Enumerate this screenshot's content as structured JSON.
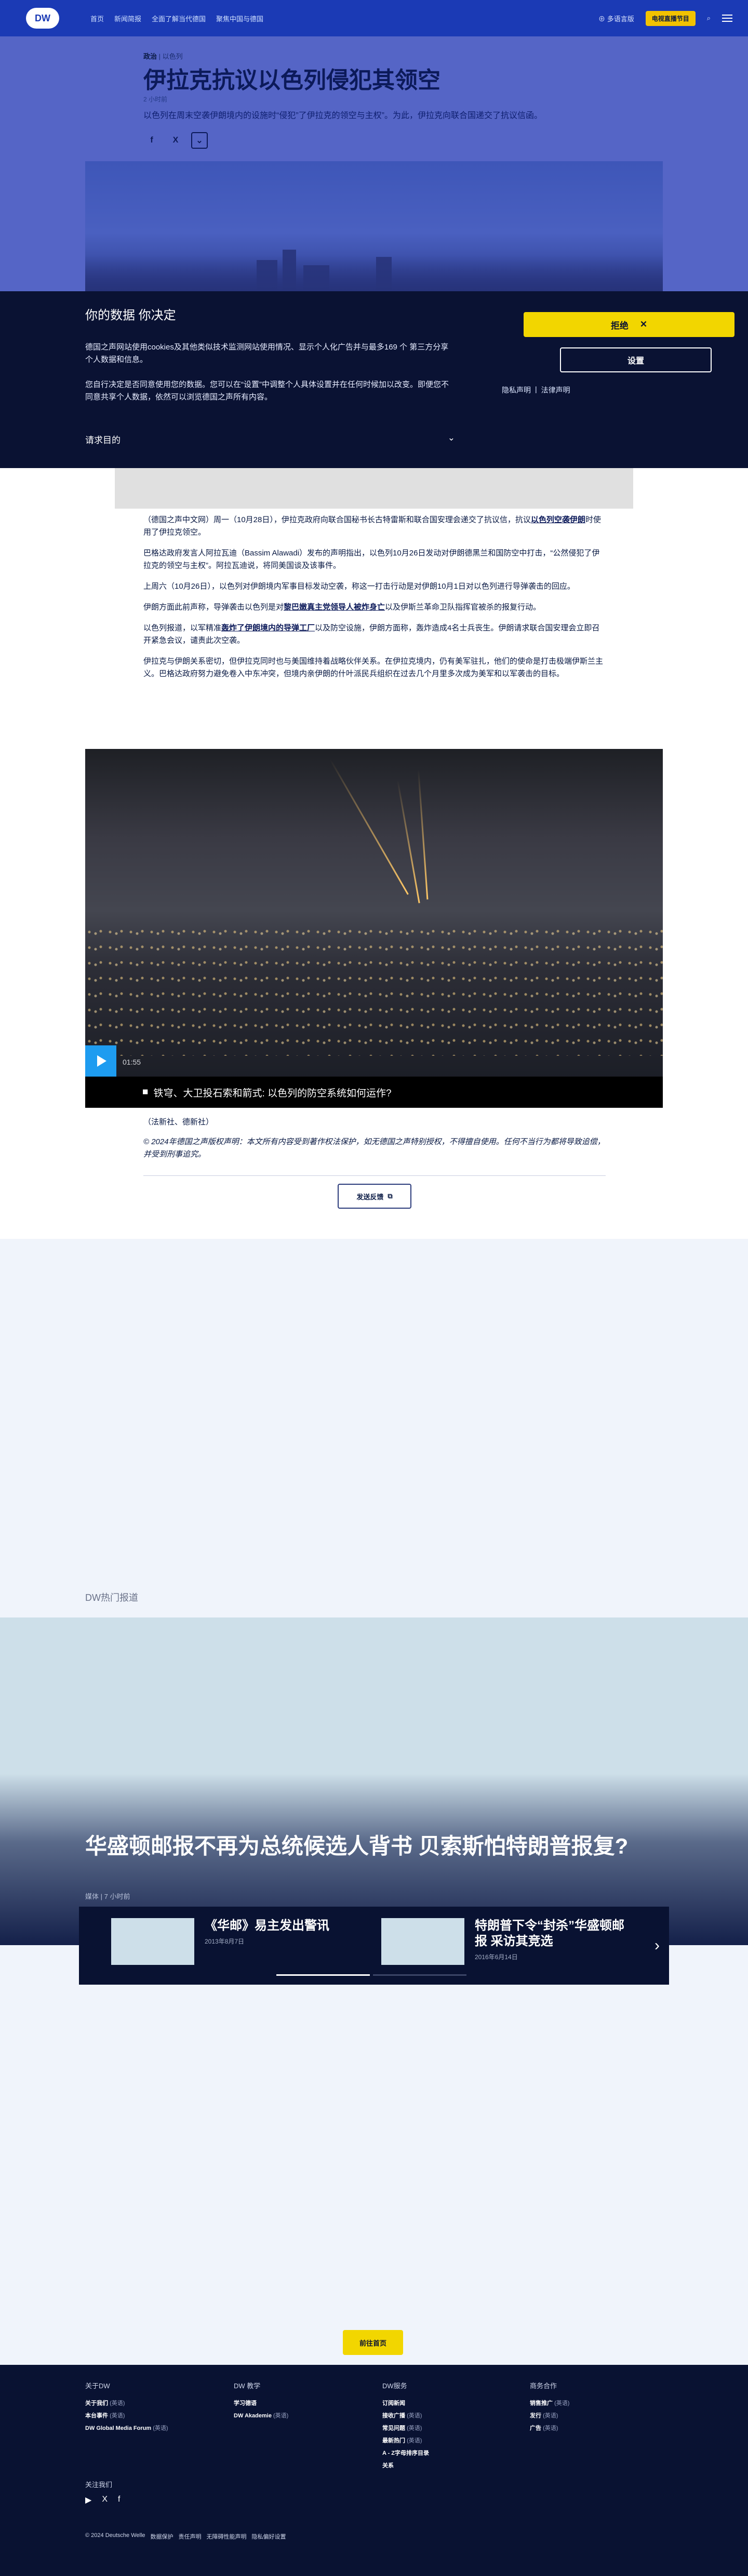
{
  "header": {
    "logo": "DW",
    "nav": [
      "首页",
      "新闻简报",
      "全面了解当代德国",
      "聚焦中国与德国"
    ],
    "language_label": "多语言版",
    "live_label": "电视直播节目",
    "search_icon": "search-icon",
    "menu_icon": "hamburger-icon"
  },
  "article": {
    "kicker_category": "政治",
    "kicker_region": "以色列",
    "title": "伊拉克抗议以色列侵犯其领空",
    "read_time": "2 小时前",
    "teaser": "以色列在周末空袭伊朗境内的设施时“侵犯”了伊拉克的领空与主权”。为此，伊拉克向联合国递交了抗议信函。",
    "share_labels": [
      "f",
      "X",
      "⌄"
    ]
  },
  "consent": {
    "title": "你的数据 你决定",
    "p1": "德国之声网站使用cookies及其他类似技术监测网站使用情况、显示个人化广告并与最多169 个 第三方分享个人数据和信息。",
    "p2": "您自行决定是否同意使用您的数据。您可以在“设置”中调整个人具体设置并在任何时候加以改变。即便您不同意共享个人数据，依然可以浏览德国之声所有内容。",
    "request_label": "请求目的",
    "reject_label": "拒绝",
    "settings_label": "设置",
    "privacy_label": "隐私声明",
    "legal_label": "法律声明"
  },
  "body": {
    "p1": "（德国之声中文网）周一（10月28日），伊拉克政府向联合国秘书长古特雷斯和联合国安理会递交了抗议信，抗议",
    "p1_link": "以色列空袭伊朗",
    "p1_tail": "时使用了伊拉克领空。",
    "p2": "巴格达政府发言人阿拉瓦迪（Bassim Alawadi）发布的声明指出，以色列10月26日发动对伊朗德黑兰和国防空中打击，“公然侵犯了伊拉克的领空与主权”。阿拉瓦迪说，将同美国谈及该事件。",
    "p3": "上周六（10月26日），以色列对伊朗境内军事目标发动空袭，称这一打击行动是对伊朗10月1日对以色列进行导弹袭击的回应。",
    "p4_pre": "伊朗方面此前声称，导弹袭击以色列是对",
    "p4_link": "黎巴嫩真主党领导人被炸身亡",
    "p4_tail": "以及伊斯兰革命卫队指挥官被杀的报复行动。",
    "p5_pre": "以色列报道，以军精准",
    "p5_link": "轰炸了伊朗境内的导弹工厂",
    "p5_tail": "以及防空设施，伊朗方面称，轰炸造成4名士兵丧生。伊朗请求联合国安理会立即召开紧急会议，谴责此次空袭。",
    "p6": "伊拉克与伊朗关系密切，但伊拉克同时也与美国维持着战略伙伴关系。在伊拉克境内，仍有美军驻扎，他们的使命是打击极端伊斯兰主义。巴格达政府努力避免卷入中东冲突，但境内亲伊朗的什叶派民兵组织在过去几个月里多次成为美军和以军袭击的目标。",
    "video_duration": "01:55",
    "video_caption": "铁穹、大卫投石索和箭式: 以色列的防空系统如何运作?",
    "credit": "（法新社、德新社）",
    "copyright": "© 2024年德国之声版权声明：本文所有内容受到著作权法保护，如无德国之声特别授权，不得擅自使用。任何不当行为都将导致追偿，并受到刑事追究。",
    "feedback_label": "发送反馈"
  },
  "hot": {
    "label": "DW热门报道",
    "feature_title": "华盛顿邮报不再为总统候选人背书 贝索斯怕特朗普报复?",
    "feature_meta": "媒体 | 7 小时前",
    "cards": [
      {
        "title": "《华邮》易主发出警讯",
        "date": "2013年8月7日"
      },
      {
        "title": "特朗普下令“封杀”华盛顿邮报 采访其竞选",
        "date": "2016年6月14日"
      }
    ]
  },
  "home_label": "前往首页",
  "footer": {
    "cols": [
      {
        "title": "关于DW",
        "items": [
          [
            "关于我们",
            "(英语)"
          ],
          [
            "本台事件",
            "(英语)"
          ],
          [
            "DW Global Media Forum",
            "(英语)"
          ]
        ]
      },
      {
        "title": "DW 教学",
        "items": [
          [
            "学习德语",
            ""
          ],
          [
            "DW Akademie",
            "(英语)"
          ]
        ]
      },
      {
        "title": "DW服务",
        "items": [
          [
            "订阅新闻",
            ""
          ],
          [
            "接收广播",
            "(英语)"
          ],
          [
            "常见问题",
            "(英语)"
          ],
          [
            "最新热门",
            "(英语)"
          ],
          [
            "A - Z字母排序目录",
            ""
          ],
          [
            "关系",
            ""
          ]
        ]
      },
      {
        "title": "商务合作",
        "items": [
          [
            "销售推广",
            "(英语)"
          ],
          [
            "发行",
            "(英语)"
          ],
          [
            "广告",
            "(英语)"
          ]
        ]
      }
    ],
    "follow_label": "关注我们",
    "legal": [
      "© 2024 Deutsche Welle",
      "数据保护",
      "责任声明",
      "无障碍性能声明",
      "隐私偏好设置"
    ]
  }
}
